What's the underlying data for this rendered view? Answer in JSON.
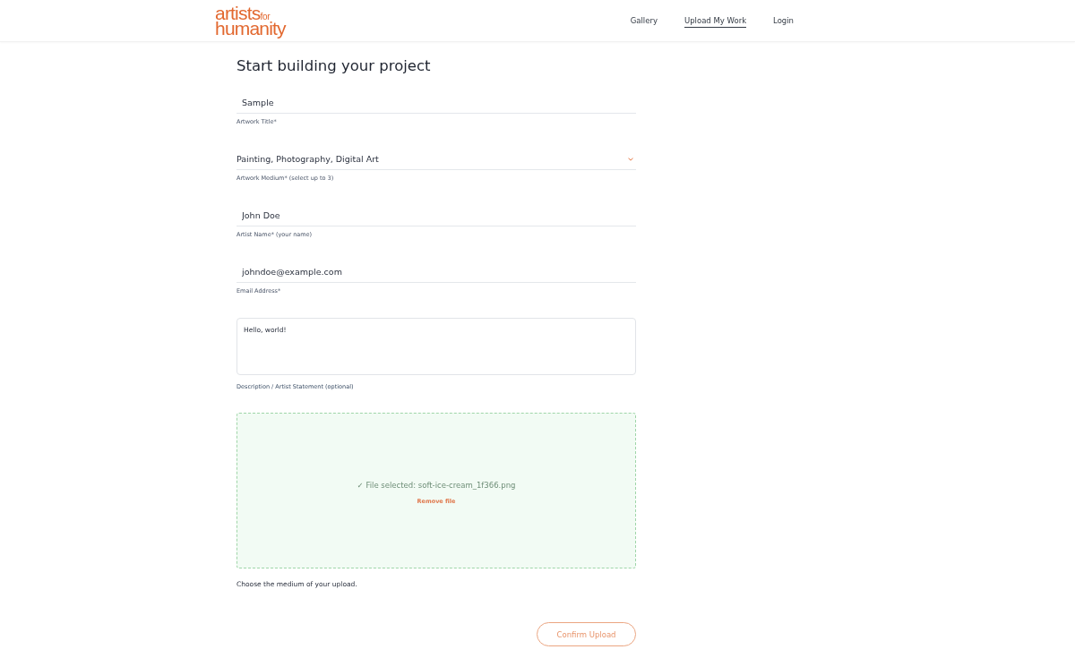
{
  "header": {
    "logo": {
      "line_1": "artists",
      "small": "for",
      "line_2": "humanity"
    },
    "nav": [
      {
        "label": "Gallery",
        "selected": false
      },
      {
        "label": "Upload My Work",
        "selected": true
      },
      {
        "label": "Login",
        "selected": false
      }
    ]
  },
  "form": {
    "title": "Start building your project",
    "fields": [
      {
        "kind": "text",
        "value": "Sample",
        "label": "Artwork Title*"
      },
      {
        "kind": "select",
        "value": "Painting, Photography, Digital Art",
        "label": "Artwork Medium* (select up to 3)"
      },
      {
        "kind": "text",
        "value": "John Doe",
        "label": "Artist Name* (your name)"
      },
      {
        "kind": "text",
        "value": "johndoe@example.com",
        "label": "Email Address*"
      },
      {
        "kind": "textarea",
        "value": "Hello, world!",
        "label": "Description / Artist Statement (optional)"
      }
    ],
    "upload": {
      "status": "✓ File selected: soft-ice-cream_1f366.png",
      "remove_link": "Remove file"
    },
    "hint": "Choose the medium of your upload.",
    "submit": "Confirm Upload"
  }
}
